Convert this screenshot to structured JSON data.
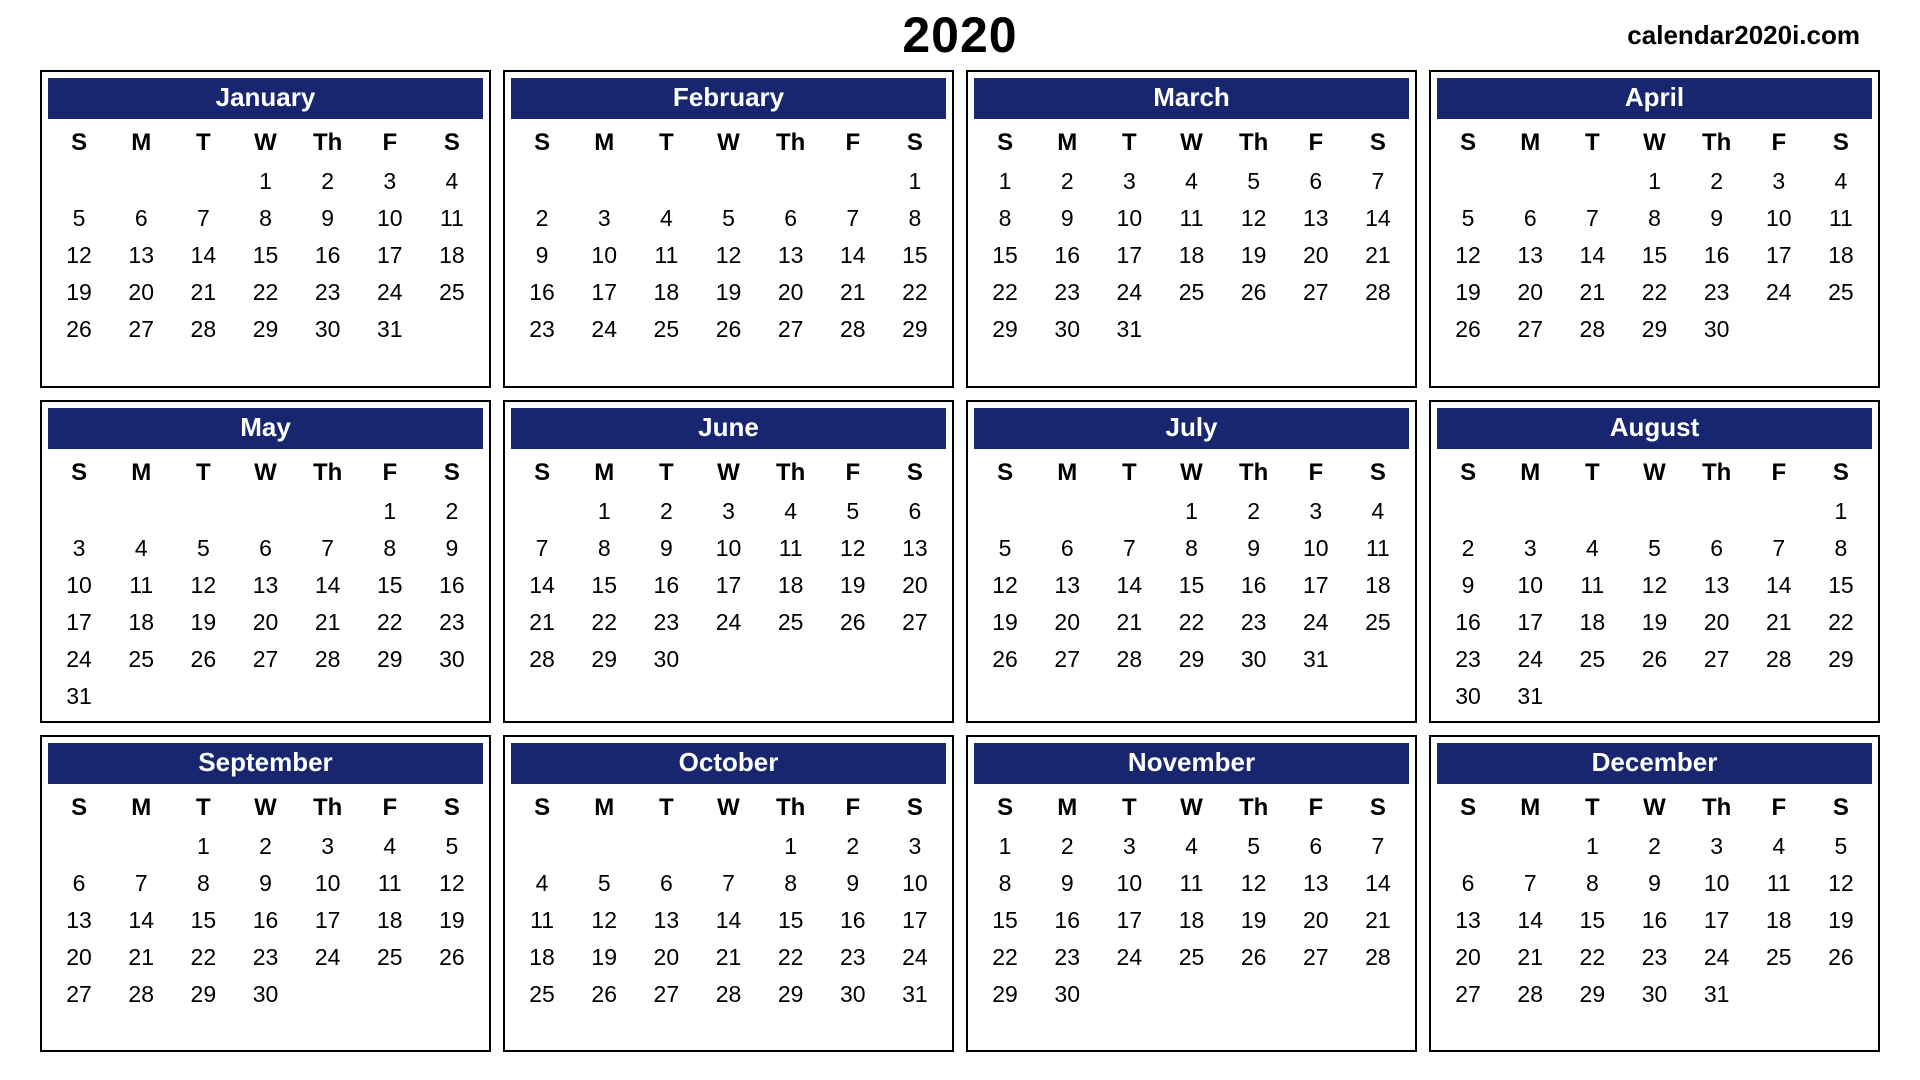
{
  "year": "2020",
  "watermark": "calendar2020i.com",
  "day_headers": [
    "S",
    "M",
    "T",
    "W",
    "Th",
    "F",
    "S"
  ],
  "months": [
    {
      "name": "January",
      "weeks": [
        [
          "",
          "",
          "",
          "1",
          "2",
          "3",
          "4"
        ],
        [
          "5",
          "6",
          "7",
          "8",
          "9",
          "10",
          "11"
        ],
        [
          "12",
          "13",
          "14",
          "15",
          "16",
          "17",
          "18"
        ],
        [
          "19",
          "20",
          "21",
          "22",
          "23",
          "24",
          "25"
        ],
        [
          "26",
          "27",
          "28",
          "29",
          "30",
          "31",
          ""
        ]
      ]
    },
    {
      "name": "February",
      "weeks": [
        [
          "",
          "",
          "",
          "",
          "",
          "",
          "1"
        ],
        [
          "2",
          "3",
          "4",
          "5",
          "6",
          "7",
          "8"
        ],
        [
          "9",
          "10",
          "11",
          "12",
          "13",
          "14",
          "15"
        ],
        [
          "16",
          "17",
          "18",
          "19",
          "20",
          "21",
          "22"
        ],
        [
          "23",
          "24",
          "25",
          "26",
          "27",
          "28",
          "29"
        ]
      ]
    },
    {
      "name": "March",
      "weeks": [
        [
          "1",
          "2",
          "3",
          "4",
          "5",
          "6",
          "7"
        ],
        [
          "8",
          "9",
          "10",
          "11",
          "12",
          "13",
          "14"
        ],
        [
          "15",
          "16",
          "17",
          "18",
          "19",
          "20",
          "21"
        ],
        [
          "22",
          "23",
          "24",
          "25",
          "26",
          "27",
          "28"
        ],
        [
          "29",
          "30",
          "31",
          "",
          "",
          "",
          ""
        ]
      ]
    },
    {
      "name": "April",
      "weeks": [
        [
          "",
          "",
          "",
          "1",
          "2",
          "3",
          "4"
        ],
        [
          "5",
          "6",
          "7",
          "8",
          "9",
          "10",
          "11"
        ],
        [
          "12",
          "13",
          "14",
          "15",
          "16",
          "17",
          "18"
        ],
        [
          "19",
          "20",
          "21",
          "22",
          "23",
          "24",
          "25"
        ],
        [
          "26",
          "27",
          "28",
          "29",
          "30",
          "",
          ""
        ]
      ]
    },
    {
      "name": "May",
      "weeks": [
        [
          "",
          "",
          "",
          "",
          "",
          "1",
          "2"
        ],
        [
          "3",
          "4",
          "5",
          "6",
          "7",
          "8",
          "9"
        ],
        [
          "10",
          "11",
          "12",
          "13",
          "14",
          "15",
          "16"
        ],
        [
          "17",
          "18",
          "19",
          "20",
          "21",
          "22",
          "23"
        ],
        [
          "24",
          "25",
          "26",
          "27",
          "28",
          "29",
          "30"
        ],
        [
          "31",
          "",
          "",
          "",
          "",
          "",
          ""
        ]
      ]
    },
    {
      "name": "June",
      "weeks": [
        [
          "",
          "1",
          "2",
          "3",
          "4",
          "5",
          "6"
        ],
        [
          "7",
          "8",
          "9",
          "10",
          "11",
          "12",
          "13"
        ],
        [
          "14",
          "15",
          "16",
          "17",
          "18",
          "19",
          "20"
        ],
        [
          "21",
          "22",
          "23",
          "24",
          "25",
          "26",
          "27"
        ],
        [
          "28",
          "29",
          "30",
          "",
          "",
          "",
          ""
        ]
      ]
    },
    {
      "name": "July",
      "weeks": [
        [
          "",
          "",
          "",
          "1",
          "2",
          "3",
          "4"
        ],
        [
          "5",
          "6",
          "7",
          "8",
          "9",
          "10",
          "11"
        ],
        [
          "12",
          "13",
          "14",
          "15",
          "16",
          "17",
          "18"
        ],
        [
          "19",
          "20",
          "21",
          "22",
          "23",
          "24",
          "25"
        ],
        [
          "26",
          "27",
          "28",
          "29",
          "30",
          "31",
          ""
        ]
      ]
    },
    {
      "name": "August",
      "weeks": [
        [
          "",
          "",
          "",
          "",
          "",
          "",
          "1"
        ],
        [
          "2",
          "3",
          "4",
          "5",
          "6",
          "7",
          "8"
        ],
        [
          "9",
          "10",
          "11",
          "12",
          "13",
          "14",
          "15"
        ],
        [
          "16",
          "17",
          "18",
          "19",
          "20",
          "21",
          "22"
        ],
        [
          "23",
          "24",
          "25",
          "26",
          "27",
          "28",
          "29"
        ],
        [
          "30",
          "31",
          "",
          "",
          "",
          "",
          ""
        ]
      ]
    },
    {
      "name": "September",
      "weeks": [
        [
          "",
          "",
          "1",
          "2",
          "3",
          "4",
          "5"
        ],
        [
          "6",
          "7",
          "8",
          "9",
          "10",
          "11",
          "12"
        ],
        [
          "13",
          "14",
          "15",
          "16",
          "17",
          "18",
          "19"
        ],
        [
          "20",
          "21",
          "22",
          "23",
          "24",
          "25",
          "26"
        ],
        [
          "27",
          "28",
          "29",
          "30",
          "",
          "",
          ""
        ]
      ]
    },
    {
      "name": "October",
      "weeks": [
        [
          "",
          "",
          "",
          "",
          "1",
          "2",
          "3"
        ],
        [
          "4",
          "5",
          "6",
          "7",
          "8",
          "9",
          "10"
        ],
        [
          "11",
          "12",
          "13",
          "14",
          "15",
          "16",
          "17"
        ],
        [
          "18",
          "19",
          "20",
          "21",
          "22",
          "23",
          "24"
        ],
        [
          "25",
          "26",
          "27",
          "28",
          "29",
          "30",
          "31"
        ]
      ]
    },
    {
      "name": "November",
      "weeks": [
        [
          "1",
          "2",
          "3",
          "4",
          "5",
          "6",
          "7"
        ],
        [
          "8",
          "9",
          "10",
          "11",
          "12",
          "13",
          "14"
        ],
        [
          "15",
          "16",
          "17",
          "18",
          "19",
          "20",
          "21"
        ],
        [
          "22",
          "23",
          "24",
          "25",
          "26",
          "27",
          "28"
        ],
        [
          "29",
          "30",
          "",
          "",
          "",
          "",
          ""
        ]
      ]
    },
    {
      "name": "December",
      "weeks": [
        [
          "",
          "",
          "1",
          "2",
          "3",
          "4",
          "5"
        ],
        [
          "6",
          "7",
          "8",
          "9",
          "10",
          "11",
          "12"
        ],
        [
          "13",
          "14",
          "15",
          "16",
          "17",
          "18",
          "19"
        ],
        [
          "20",
          "21",
          "22",
          "23",
          "24",
          "25",
          "26"
        ],
        [
          "27",
          "28",
          "29",
          "30",
          "31",
          "",
          ""
        ]
      ]
    }
  ]
}
